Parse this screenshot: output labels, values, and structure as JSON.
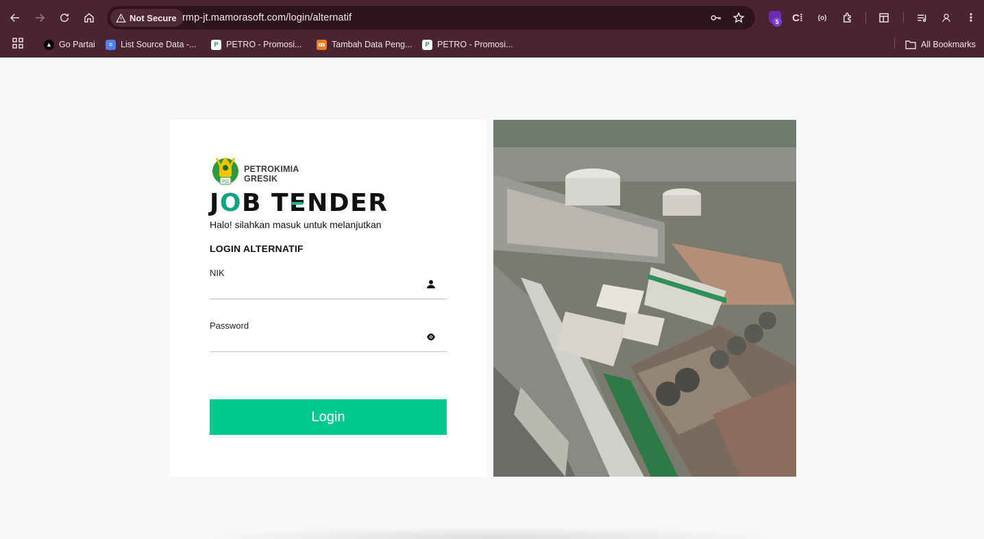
{
  "browser": {
    "security_label": "Not Secure",
    "url": "rmp-jt.mamorasoft.com/login/alternatif",
    "extension_badge_count": "5",
    "bookmarks": [
      {
        "label": "Go Partai",
        "icon": "triangle-logo",
        "color": "#000000"
      },
      {
        "label": "List Source Data -...",
        "icon": "docs-icon",
        "color": "#4f7ff0"
      },
      {
        "label": "PETRO - Promosi...",
        "icon": "petro-icon",
        "color": "#ffffff"
      },
      {
        "label": "Tambah Data Peng...",
        "icon": "xampp-icon",
        "color": "#f47b20"
      },
      {
        "label": "PETRO - Promosi...",
        "icon": "petro-icon",
        "color": "#ffffff"
      }
    ],
    "all_bookmarks_label": "All Bookmarks"
  },
  "page": {
    "logo_line1": "PETROKIMIA",
    "logo_line2": "GRESIK",
    "logo_seal_text": "PG",
    "brand_parts": [
      "J",
      "O",
      "B T",
      "E",
      "NDER"
    ],
    "subtitle": "Halo! silahkan masuk untuk melanjutkan",
    "section_title": "LOGIN ALTERNATIF",
    "nik_label": "NIK",
    "nik_value": "",
    "password_label": "Password",
    "password_value": "",
    "login_button": "Login"
  },
  "colors": {
    "chrome_bg": "#4a2430",
    "accent": "#00c98f",
    "brand_green": "#0fa37f",
    "page_bg": "#f6f7f9"
  }
}
